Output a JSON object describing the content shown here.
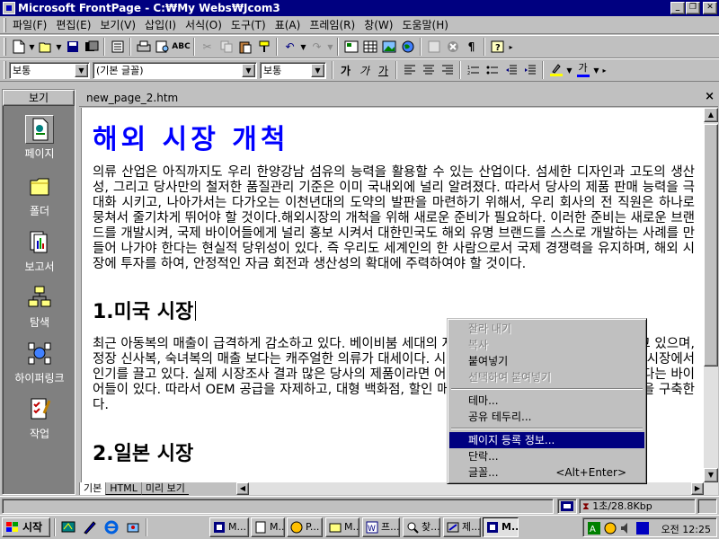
{
  "window": {
    "title": "Microsoft FrontPage - C:₩My Webs₩Jcom3"
  },
  "menu": [
    "파일(F)",
    "편집(E)",
    "보기(V)",
    "삽입(I)",
    "서식(O)",
    "도구(T)",
    "표(A)",
    "프레임(R)",
    "창(W)",
    "도움말(H)"
  ],
  "format_toolbar": {
    "style": "보통",
    "font": "(기본 글꼴)",
    "size": "보통",
    "bold_label": "가",
    "italic_label": "가",
    "underline_label": "가",
    "font_color_label": "가",
    "highlight_color": "#ffff00",
    "font_color": "#0000ff"
  },
  "views_bar": {
    "header": "보기",
    "items": [
      {
        "label": "페이지",
        "icon": "page-icon",
        "active": true
      },
      {
        "label": "폴더",
        "icon": "folder-icon"
      },
      {
        "label": "보고서",
        "icon": "reports-icon"
      },
      {
        "label": "탐색",
        "icon": "navigation-icon"
      },
      {
        "label": "하이퍼링크",
        "icon": "hyperlinks-icon"
      },
      {
        "label": "작업",
        "icon": "tasks-icon"
      }
    ]
  },
  "editor": {
    "doc_tab": "new_page_2.htm",
    "close_symbol": "×",
    "bottom_tabs": [
      "기본",
      "HTML",
      "미리 보기"
    ]
  },
  "document": {
    "heading": "해외 시장 개척",
    "intro": "의류 산업은 아직까지도 우리 한양강남 섬유의 능력을 활용할 수 있는 산업이다. 섬세한 디자인과 고도의 생산성, 그리고 당사만의 철저한 품질관리 기준은 이미 국내외에 널리 알려졌다. 따라서 당사의 제품 판매 능력을 극대화 시키고, 나아가서는 다가오는 이천년대의 도약의 발판을 마련하기 위해서, 우리 회사의 전 직원은 하나로 뭉쳐서 줄기차게 뛰어야 할 것이다.해외시장의 개척을 위해 새로운 준비가 필요하다. 이러한 준비는 새로운 브랜드를 개발시켜, 국제 바이어들에게 널리 홍보 시켜서 대한민국도 해외 유명 브랜드를 스스로 개발하는 사례를 만들어 나가야 한다는 현실적 당위성이 있다. 즉 우리도 세계인의 한 사람으로서 국제 경쟁력을 유지하며, 해외 시장에 투자를 하여, 안정적인 자금 회전과 생산성의 확대에 주력하여야 할 것이다.",
    "section1_title": "1.미국 시장",
    "section1_body": "최근 아동복의 매출이 급격하게 감소하고 있다. 베이비붐 세대의 자녀들이 성장하면서 주된 고객이 되고 있으며, 정장 신사복, 숙녀복의 매출 보다는 캐주얼한 의류가 대세이다. 시장의 세분화와 캐주얼 저가 제품들이 시장에서 인기를 끌고 있다. 실제 시장조사 결과 많은 당사의 제품이라면 어떤 종류나 수량에 관계없이 구매하겠다는 바이어들이 있다. 따라서 OEM 공급을 자제하고, 대형 백화점, 할인 매장에 직접 판매를 할 수 있는 유통망을 구축한다.",
    "section2_title": "2.일본 시장"
  },
  "context_menu": {
    "items": [
      {
        "label": "잘라 내기",
        "disabled": true
      },
      {
        "label": "복사",
        "disabled": true
      },
      {
        "label": "붙여넣기",
        "disabled": false
      },
      {
        "label": "선택하여 붙여넣기",
        "disabled": true
      },
      {
        "sep": true
      },
      {
        "label": "테마...",
        "disabled": false
      },
      {
        "label": "공유 테두리...",
        "disabled": false
      },
      {
        "sep": true
      },
      {
        "label": "페이지 등록 정보...",
        "disabled": false,
        "highlighted": true
      },
      {
        "label": "단락...",
        "disabled": false
      },
      {
        "label": "글꼴...",
        "disabled": false,
        "shortcut": "<Alt+Enter>"
      }
    ]
  },
  "status_bar": {
    "speed": "1초/28.8Kbp"
  },
  "taskbar": {
    "start_label": "시작",
    "tasks": [
      {
        "label": "M..."
      },
      {
        "label": "M..."
      },
      {
        "label": "P..."
      },
      {
        "label": "M..."
      },
      {
        "label": "프..."
      },
      {
        "label": "찾..."
      },
      {
        "label": "제..."
      },
      {
        "label": "M...",
        "active": true
      }
    ],
    "clock": "오전 12:25"
  }
}
